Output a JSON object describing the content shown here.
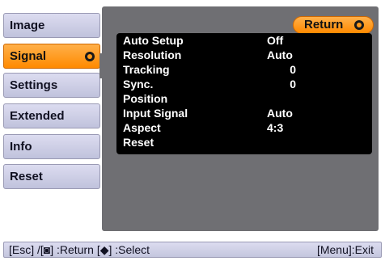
{
  "sidebar": {
    "items": [
      {
        "label": "Image"
      },
      {
        "label": "Signal"
      },
      {
        "label": "Settings"
      },
      {
        "label": "Extended"
      },
      {
        "label": "Info"
      },
      {
        "label": "Reset"
      }
    ],
    "active_index": 1
  },
  "main": {
    "return_label": "Return",
    "items": [
      {
        "label": "Auto Setup",
        "value": "Off"
      },
      {
        "label": "Resolution",
        "value": "Auto"
      },
      {
        "label": "Tracking",
        "value": "0"
      },
      {
        "label": "Sync.",
        "value": "0"
      },
      {
        "label": "Position",
        "value": ""
      },
      {
        "label": "Input Signal",
        "value": "Auto"
      },
      {
        "label": "Aspect",
        "value": "4:3"
      },
      {
        "label": "Reset",
        "value": ""
      }
    ]
  },
  "help_bar": {
    "left": "[Esc] /[◙] :Return  [◆] :Select",
    "right": "[Menu]:Exit"
  },
  "colors": {
    "accent": "#ff9a1a",
    "tab": "#c8cae2",
    "panel": "#6f6f73",
    "list": "#000000"
  },
  "icons": {
    "enter": "enter-icon",
    "updown": "updown-icon"
  }
}
